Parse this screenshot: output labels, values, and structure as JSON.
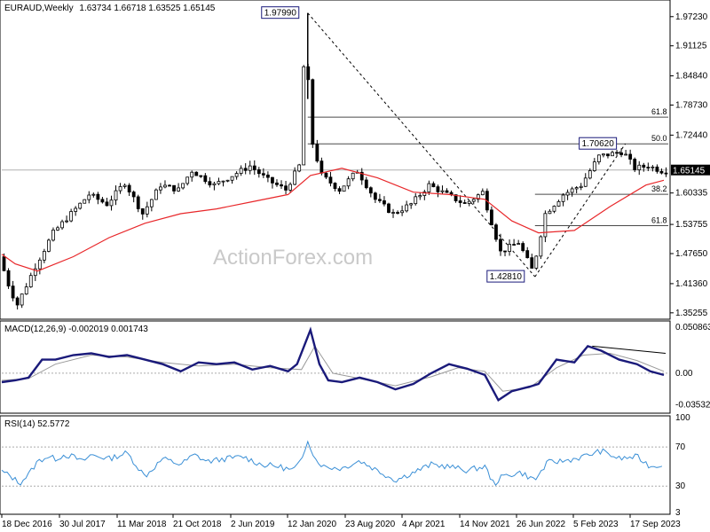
{
  "chart_data": [
    {
      "type": "candlestick",
      "panel": "price",
      "title": "EURAUD,Weekly",
      "ohlc_text": "1.63734 1.66718 1.63525 1.65145",
      "current_price": 1.65145,
      "current_price_label": "1.65145",
      "ylim": [
        1.3485,
        1.996
      ],
      "y_ticks": [
        {
          "value": 1.9723,
          "label": "1.97230"
        },
        {
          "value": 1.91125,
          "label": "1.91125"
        },
        {
          "value": 1.8484,
          "label": "1.84840"
        },
        {
          "value": 1.7873,
          "label": "1.78730"
        },
        {
          "value": 1.7244,
          "label": "1.72440"
        },
        {
          "value": 1.60335,
          "label": "1.60335"
        },
        {
          "value": 1.53755,
          "label": "1.53755"
        },
        {
          "value": 1.4765,
          "label": "1.47650"
        },
        {
          "value": 1.4136,
          "label": "1.41360"
        },
        {
          "value": 1.35255,
          "label": "1.35255"
        }
      ],
      "x_labels": [
        "18 Dec 2016",
        "30 Jul 2017",
        "11 Mar 2018",
        "21 Oct 2018",
        "2 Jun 2019",
        "12 Jan 2020",
        "23 Aug 2020",
        "4 Apr 2021",
        "14 Nov 2021",
        "26 Jun 2022",
        "5 Feb 2023",
        "17 Sep 2023"
      ],
      "annotations": [
        {
          "text": "1.97990",
          "value": 1.9799,
          "bar": 342
        },
        {
          "text": "1.70620",
          "value": 1.7062,
          "bar": 697
        },
        {
          "text": "1.42810",
          "value": 1.4281,
          "bar": 596
        }
      ],
      "fib_levels": [
        {
          "label": "61.8",
          "value": 1.762
        },
        {
          "label": "50.0",
          "value": 1.7062
        },
        {
          "label": "38.2",
          "value": 1.6005
        },
        {
          "label": "61.8",
          "value": 1.535
        }
      ],
      "trendlines": [
        {
          "from": [
            342,
            1.9799
          ],
          "to": [
            596,
            1.4281
          ]
        },
        {
          "from": [
            596,
            1.4281
          ],
          "to": [
            697,
            1.7062
          ]
        }
      ],
      "ma_series": [
        [
          0,
          1.475
        ],
        [
          15,
          1.455
        ],
        [
          40,
          1.44
        ],
        [
          80,
          1.47
        ],
        [
          120,
          1.51
        ],
        [
          160,
          1.54
        ],
        [
          200,
          1.56
        ],
        [
          240,
          1.57
        ],
        [
          280,
          1.585
        ],
        [
          320,
          1.6
        ],
        [
          345,
          1.64
        ],
        [
          380,
          1.655
        ],
        [
          420,
          1.635
        ],
        [
          460,
          1.605
        ],
        [
          500,
          1.6
        ],
        [
          540,
          1.59
        ],
        [
          570,
          1.545
        ],
        [
          600,
          1.52
        ],
        [
          640,
          1.525
        ],
        [
          680,
          1.575
        ],
        [
          720,
          1.62
        ],
        [
          740,
          1.63
        ]
      ],
      "price_series": [
        [
          0,
          1.47
        ],
        [
          12,
          1.4
        ],
        [
          20,
          1.37
        ],
        [
          40,
          1.45
        ],
        [
          60,
          1.52
        ],
        [
          80,
          1.56
        ],
        [
          100,
          1.6
        ],
        [
          120,
          1.58
        ],
        [
          140,
          1.625
        ],
        [
          160,
          1.56
        ],
        [
          180,
          1.62
        ],
        [
          200,
          1.61
        ],
        [
          215,
          1.65
        ],
        [
          240,
          1.62
        ],
        [
          260,
          1.64
        ],
        [
          280,
          1.66
        ],
        [
          300,
          1.63
        ],
        [
          320,
          1.61
        ],
        [
          335,
          1.66
        ],
        [
          342,
          1.95
        ],
        [
          348,
          1.72
        ],
        [
          360,
          1.64
        ],
        [
          380,
          1.61
        ],
        [
          400,
          1.65
        ],
        [
          420,
          1.59
        ],
        [
          440,
          1.56
        ],
        [
          460,
          1.58
        ],
        [
          480,
          1.62
        ],
        [
          500,
          1.6
        ],
        [
          520,
          1.58
        ],
        [
          540,
          1.605
        ],
        [
          560,
          1.48
        ],
        [
          580,
          1.5
        ],
        [
          596,
          1.44
        ],
        [
          610,
          1.56
        ],
        [
          630,
          1.6
        ],
        [
          650,
          1.62
        ],
        [
          670,
          1.68
        ],
        [
          697,
          1.69
        ],
        [
          710,
          1.655
        ],
        [
          725,
          1.66
        ],
        [
          740,
          1.65
        ]
      ]
    },
    {
      "type": "line",
      "panel": "macd",
      "title": "MACD(12,26,9) -0.002019 0.001743",
      "ylim": [
        -0.0425,
        0.056
      ],
      "y_ticks": [
        {
          "value": 0.050863,
          "label": "0.050863"
        },
        {
          "value": 0.0,
          "label": "0.00"
        },
        {
          "value": -0.035322,
          "label": "-0.035322"
        }
      ],
      "macd_series": [
        [
          0,
          -0.01
        ],
        [
          15,
          -0.008
        ],
        [
          30,
          -0.005
        ],
        [
          45,
          0.015
        ],
        [
          60,
          0.015
        ],
        [
          80,
          0.02
        ],
        [
          100,
          0.022
        ],
        [
          120,
          0.018
        ],
        [
          140,
          0.02
        ],
        [
          160,
          0.015
        ],
        [
          180,
          0.01
        ],
        [
          200,
          0.002
        ],
        [
          220,
          0.012
        ],
        [
          240,
          0.01
        ],
        [
          260,
          0.012
        ],
        [
          280,
          0.004
        ],
        [
          300,
          0.008
        ],
        [
          320,
          0.002
        ],
        [
          330,
          0.01
        ],
        [
          345,
          0.048
        ],
        [
          355,
          0.01
        ],
        [
          365,
          -0.008
        ],
        [
          380,
          -0.01
        ],
        [
          400,
          -0.005
        ],
        [
          420,
          -0.01
        ],
        [
          440,
          -0.018
        ],
        [
          460,
          -0.012
        ],
        [
          480,
          0.0
        ],
        [
          500,
          0.01
        ],
        [
          520,
          0.005
        ],
        [
          540,
          -0.002
        ],
        [
          555,
          -0.03
        ],
        [
          570,
          -0.02
        ],
        [
          590,
          -0.015
        ],
        [
          600,
          -0.012
        ],
        [
          620,
          0.015
        ],
        [
          640,
          0.012
        ],
        [
          655,
          0.03
        ],
        [
          670,
          0.025
        ],
        [
          690,
          0.015
        ],
        [
          710,
          0.01
        ],
        [
          725,
          0.002
        ],
        [
          740,
          -0.002
        ]
      ],
      "signal_series": [
        [
          0,
          -0.008
        ],
        [
          30,
          -0.006
        ],
        [
          60,
          0.01
        ],
        [
          100,
          0.02
        ],
        [
          140,
          0.018
        ],
        [
          180,
          0.012
        ],
        [
          220,
          0.008
        ],
        [
          260,
          0.01
        ],
        [
          300,
          0.006
        ],
        [
          335,
          0.004
        ],
        [
          350,
          0.03
        ],
        [
          370,
          0.0
        ],
        [
          400,
          -0.006
        ],
        [
          440,
          -0.014
        ],
        [
          480,
          -0.004
        ],
        [
          510,
          0.006
        ],
        [
          540,
          0.002
        ],
        [
          560,
          -0.02
        ],
        [
          590,
          -0.016
        ],
        [
          620,
          0.006
        ],
        [
          650,
          0.02
        ],
        [
          680,
          0.022
        ],
        [
          710,
          0.014
        ],
        [
          740,
          0.002
        ]
      ],
      "trendline": {
        "from": [
          660,
          0.03
        ],
        "to": [
          742,
          0.022
        ]
      }
    },
    {
      "type": "line",
      "panel": "rsi",
      "title": "RSI(14) 52.5772",
      "ylim": [
        3,
        100
      ],
      "y_ticks": [
        {
          "value": 100,
          "label": "100"
        },
        {
          "value": 70,
          "label": "70"
        },
        {
          "value": 30,
          "label": "30"
        },
        {
          "value": 3,
          "label": "3"
        }
      ],
      "rsi_series": [
        [
          0,
          45
        ],
        [
          10,
          40
        ],
        [
          20,
          33
        ],
        [
          30,
          42
        ],
        [
          40,
          55
        ],
        [
          50,
          60
        ],
        [
          60,
          58
        ],
        [
          70,
          62
        ],
        [
          80,
          60
        ],
        [
          90,
          55
        ],
        [
          100,
          62
        ],
        [
          120,
          58
        ],
        [
          140,
          64
        ],
        [
          160,
          40
        ],
        [
          180,
          58
        ],
        [
          200,
          52
        ],
        [
          215,
          62
        ],
        [
          230,
          55
        ],
        [
          250,
          58
        ],
        [
          270,
          60
        ],
        [
          290,
          52
        ],
        [
          310,
          50
        ],
        [
          325,
          46
        ],
        [
          335,
          55
        ],
        [
          342,
          78
        ],
        [
          350,
          58
        ],
        [
          360,
          50
        ],
        [
          380,
          48
        ],
        [
          400,
          56
        ],
        [
          420,
          46
        ],
        [
          440,
          36
        ],
        [
          460,
          44
        ],
        [
          480,
          52
        ],
        [
          500,
          50
        ],
        [
          520,
          46
        ],
        [
          540,
          50
        ],
        [
          550,
          32
        ],
        [
          560,
          40
        ],
        [
          580,
          44
        ],
        [
          596,
          36
        ],
        [
          610,
          54
        ],
        [
          630,
          56
        ],
        [
          650,
          60
        ],
        [
          670,
          66
        ],
        [
          690,
          58
        ],
        [
          710,
          60
        ],
        [
          725,
          50
        ],
        [
          740,
          52
        ]
      ]
    }
  ],
  "watermark": "ActionForex.com",
  "colors": {
    "ma": "#e8272a",
    "macd": "#1a1a7a",
    "signal": "#9a9a9a",
    "rsi": "#3a8fd6",
    "candle": "#000000",
    "fib": "#4a4a4a"
  }
}
